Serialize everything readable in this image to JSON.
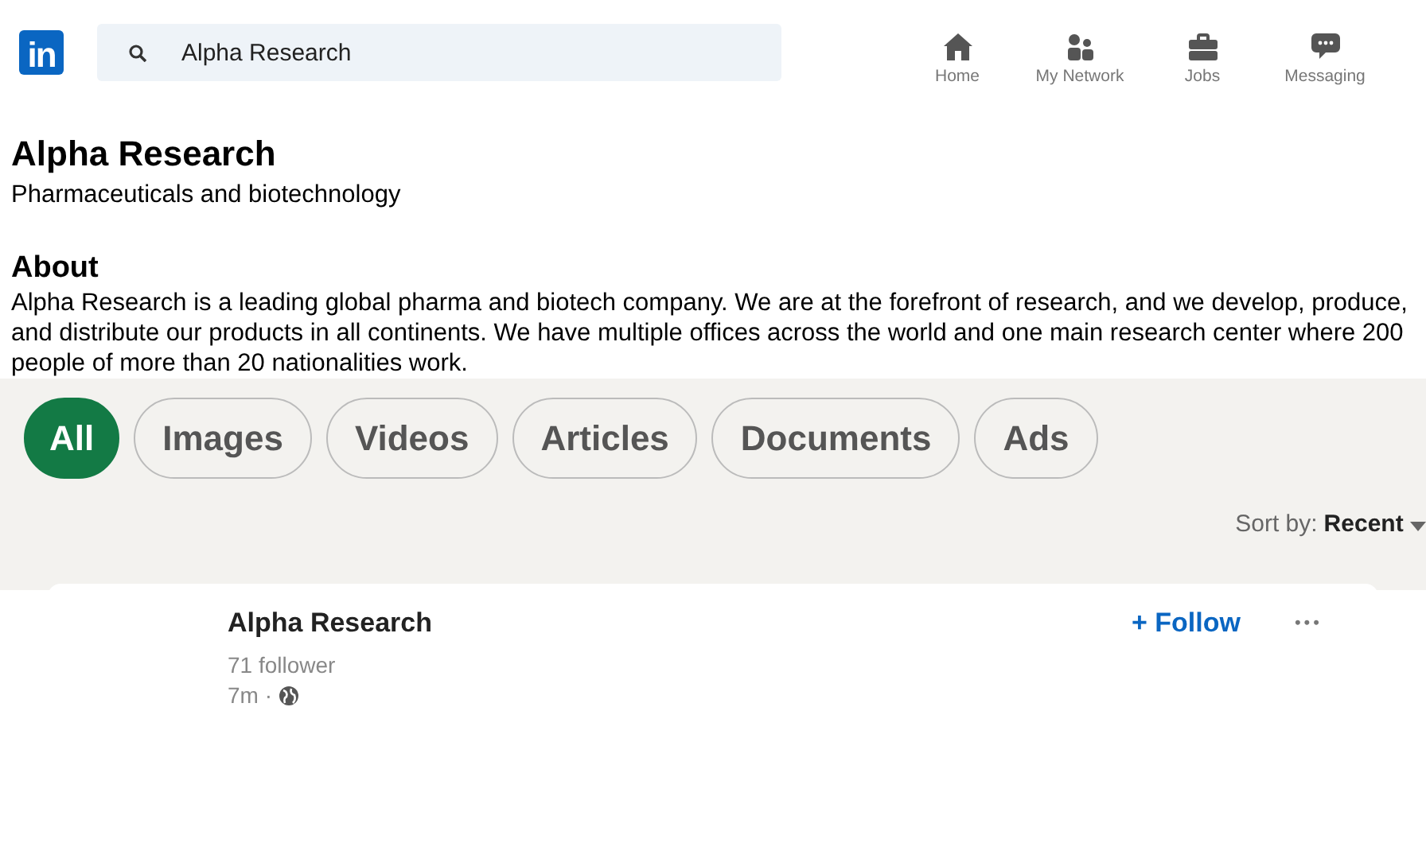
{
  "header": {
    "logo": "in",
    "search": {
      "value": "Alpha Research"
    },
    "nav": [
      {
        "label": "Home",
        "kind": "home"
      },
      {
        "label": "My Network",
        "kind": "network"
      },
      {
        "label": "Jobs",
        "kind": "jobs"
      },
      {
        "label": "Messaging",
        "kind": "messaging"
      }
    ]
  },
  "company": {
    "name": "Alpha Research",
    "industry": "Pharmaceuticals and biotechnology"
  },
  "about": {
    "heading": "About",
    "text": "Alpha Research is a leading global pharma and biotech company. We are at the forefront of research, and we develop, produce, and distribute our products in all continents. We have multiple offices across the world and one main research center where 200 people of more than 20 nationalities work."
  },
  "filters": [
    {
      "label": "All",
      "selected": true
    },
    {
      "label": "Images",
      "selected": false
    },
    {
      "label": "Videos",
      "selected": false
    },
    {
      "label": "Articles",
      "selected": false
    },
    {
      "label": "Documents",
      "selected": false
    },
    {
      "label": "Ads",
      "selected": false
    }
  ],
  "sort": {
    "label": "Sort by:",
    "value": "Recent"
  },
  "post": {
    "author": "Alpha Research",
    "followers": "71 follower",
    "time": "7m ·",
    "follow": "+ Follow",
    "more": "•••"
  }
}
